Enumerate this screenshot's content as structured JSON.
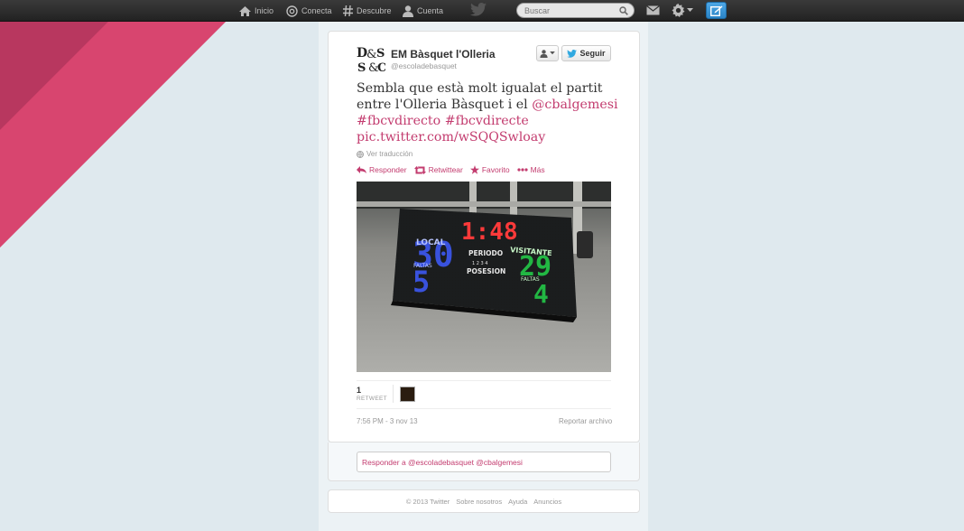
{
  "topbar": {
    "nav": [
      {
        "label": "Inicio",
        "icon": "home-icon"
      },
      {
        "label": "Conecta",
        "icon": "at-icon"
      },
      {
        "label": "Descubre",
        "icon": "hashtag-icon"
      },
      {
        "label": "Cuenta",
        "icon": "person-icon"
      }
    ],
    "search_placeholder": "Buscar",
    "compose_color": "#2b84c6"
  },
  "tweet": {
    "user_name": "EM Bàsquet l'Olleria",
    "user_handle": "@escoladebasquet",
    "follow_label": "Seguir",
    "text_prefix": "Sembla que està molt igualat el partit entre l'Olleria Bàsquet i el ",
    "mention": "@cbalgemesi",
    "hashtag1": "#fbcvdirecto",
    "hashtag2": "#fbcvdirecte",
    "link": "pic.twitter.com/wSQQSwloay",
    "translate_label": "Ver traducción",
    "actions": {
      "reply": "Responder",
      "retweet": "Retwittear",
      "favorite": "Favorito",
      "more": "Más"
    },
    "retweet_count": "1",
    "retweet_label": "RETWEET",
    "timestamp": "7:56 PM - 3 nov 13",
    "report_label": "Reportar archivo",
    "link_color": "#c33c6f"
  },
  "scoreboard": {
    "clock": "1:48",
    "local_label": "LOCAL",
    "visitor_label": "VISITANTE",
    "period_label": "PERIODO",
    "period_digits": "1 2 3 4",
    "possession_label": "POSESION",
    "fouls_label": "FALTAS",
    "local_score": "30",
    "visitor_score": "29",
    "local_fouls": "5",
    "visitor_fouls": "4"
  },
  "reply": {
    "placeholder": "Responder a @escoladebasquet @cbalgemesi"
  },
  "footer": {
    "copyright": "© 2013 Twitter",
    "links": [
      "Sobre nosotros",
      "Ayuda",
      "Anuncios"
    ]
  }
}
